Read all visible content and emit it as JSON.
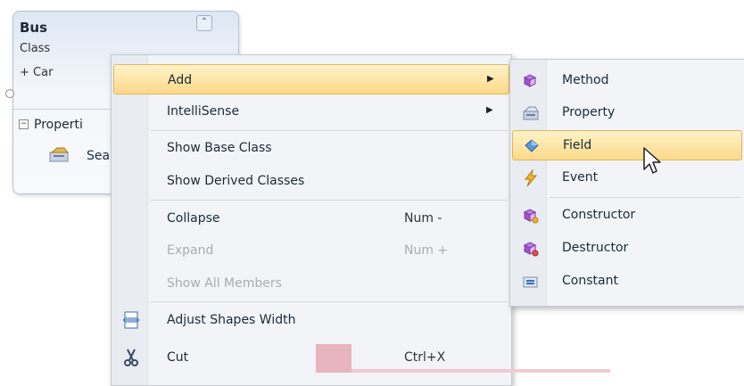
{
  "class_shape": {
    "name": "Bus",
    "kind": "Class",
    "base": "+ Car",
    "collapse_glyph": "⌃",
    "compartment": {
      "toggle": "−",
      "label": "Properti"
    },
    "member": {
      "label": "Sea",
      "icon": "property-icon"
    }
  },
  "context_menu": {
    "items": [
      {
        "label": "Add",
        "has_submenu": true,
        "highlighted": true
      },
      {
        "label": "IntelliSense",
        "has_submenu": true
      },
      {
        "label": "Show Base Class"
      },
      {
        "label": "Show Derived Classes"
      },
      {
        "label": "Collapse",
        "shortcut": "Num -"
      },
      {
        "label": "Expand",
        "shortcut": "Num +",
        "disabled": true
      },
      {
        "label": "Show All Members",
        "disabled": true
      },
      {
        "label": "Adjust Shapes Width",
        "icon": "adjust-width-icon"
      },
      {
        "label": "Cut",
        "shortcut": "Ctrl+X",
        "icon": "scissors-icon"
      }
    ],
    "submenu_arrow": "▶"
  },
  "add_submenu": {
    "items": [
      {
        "label": "Method",
        "icon": "method-icon"
      },
      {
        "label": "Property",
        "icon": "property-icon"
      },
      {
        "label": "Field",
        "icon": "field-icon",
        "highlighted": true
      },
      {
        "label": "Event",
        "icon": "event-icon"
      },
      {
        "label": "Constructor",
        "icon": "constructor-icon"
      },
      {
        "label": "Destructor",
        "icon": "destructor-icon"
      },
      {
        "label": "Constant",
        "icon": "constant-icon"
      }
    ]
  },
  "colors": {
    "highlight_top": "#fff3c8",
    "highlight_bottom": "#fcd98a",
    "highlight_border": "#e4b55a",
    "menu_bg": "#f2f4f7"
  }
}
